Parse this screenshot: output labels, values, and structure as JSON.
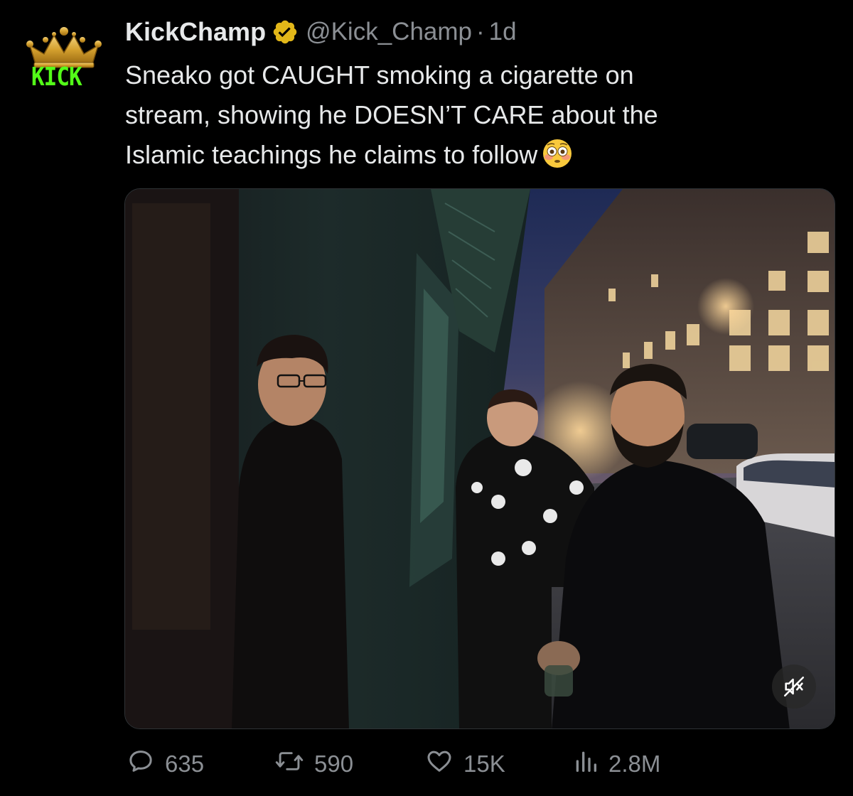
{
  "tweet": {
    "author": {
      "display_name": "KickChamp",
      "handle": "@Kick_Champ",
      "separator": "·",
      "time": "1d",
      "avatar_text": "KICK",
      "avatar_icon": "crown-icon",
      "verified_icon": "verified-badge-icon",
      "brand_color": "#53fc18",
      "verified_color": "#e2b719"
    },
    "text_lines": [
      "Sneako got CAUGHT smoking a cigarette on",
      "stream, showing he DOESN’T CARE about the",
      "Islamic teachings he claims to follow"
    ],
    "emoji": "flushed-face-emoji",
    "media": {
      "type": "video",
      "mute_icon": "muted-speaker-icon"
    },
    "actions": {
      "replies": "635",
      "retweets": "590",
      "likes": "15K",
      "views": "2.8M"
    },
    "colors": {
      "background": "#000000",
      "text": "#e7e9ea",
      "secondary_text": "#8b8f94"
    }
  }
}
